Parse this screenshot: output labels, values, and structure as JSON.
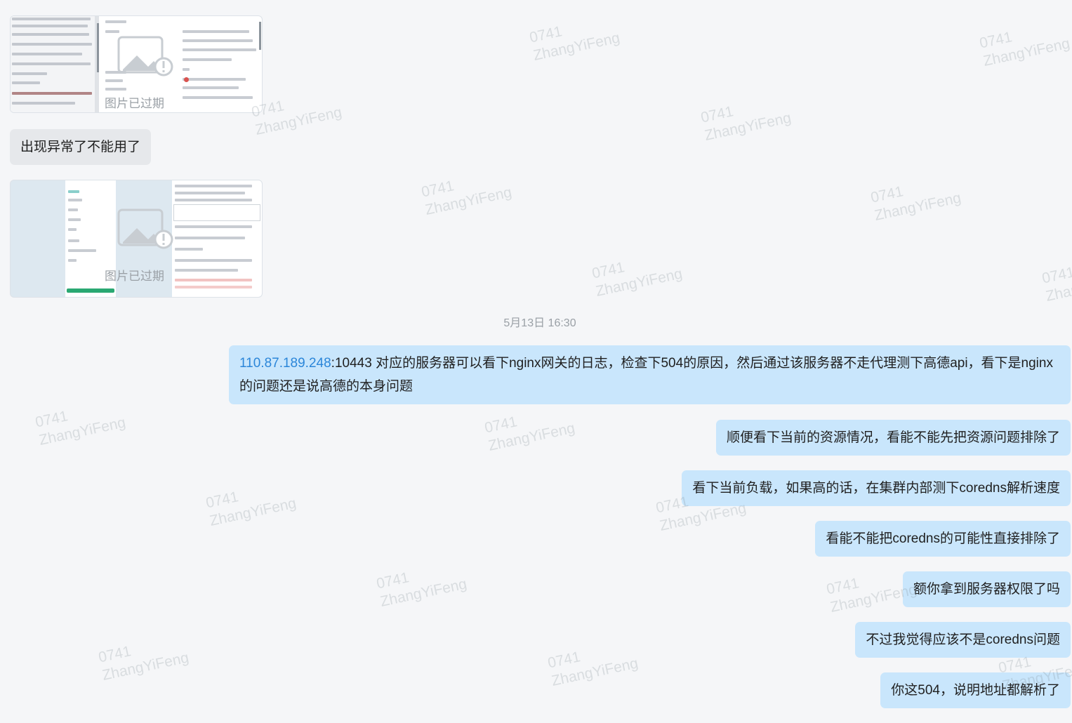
{
  "conversation": {
    "images": [
      {
        "status_text": "图片已过期"
      },
      {
        "status_text": "图片已过期"
      }
    ],
    "incoming_message": "出现异常了不能用了",
    "timestamp": "5月13日 16:30",
    "outgoing_messages": [
      {
        "link": "110.87.189.248",
        "text": ":10443 对应的服务器可以看下nginx网关的日志，检查下504的原因，然后通过该服务器不走代理测下高德api，看下是nginx的问题还是说高德的本身问题"
      },
      {
        "text": "顺便看下当前的资源情况，看能不能先把资源问题排除了"
      },
      {
        "text": "看下当前负载，如果高的话，在集群内部测下coredns解析速度"
      },
      {
        "text": "看能不能把coredns的可能性直接排除了"
      },
      {
        "text": "额你拿到服务器权限了吗"
      },
      {
        "text": "不过我觉得应该不是coredns问题"
      },
      {
        "text": "你这504，说明地址都解析了"
      }
    ]
  },
  "watermark": {
    "line1": "0741",
    "line2": "ZhangYiFeng"
  },
  "colors": {
    "background": "#f5f6f8",
    "incoming_bubble": "#e6e8eb",
    "outgoing_bubble": "#c9e6fc",
    "link": "#2b86d9",
    "muted_text": "#9aa0a6"
  },
  "icons": {
    "expired_image": "broken-image-icon"
  }
}
